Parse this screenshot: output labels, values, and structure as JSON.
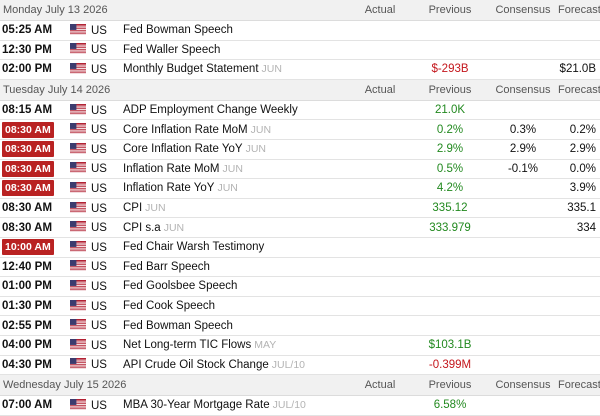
{
  "columns": {
    "actual": "Actual",
    "previous": "Previous",
    "consensus": "Consensus",
    "forecast": "Forecast"
  },
  "days": [
    {
      "label": "Monday July 13 2026",
      "events": [
        {
          "time": "05:25 AM",
          "highlight": false,
          "country": "US",
          "event": "Fed Bowman Speech",
          "ref": "",
          "actual": "",
          "actual_color": "",
          "previous": "",
          "previous_color": "",
          "consensus": "",
          "forecast": ""
        },
        {
          "time": "12:30 PM",
          "highlight": false,
          "country": "US",
          "event": "Fed Waller Speech",
          "ref": "",
          "actual": "",
          "actual_color": "",
          "previous": "",
          "previous_color": "",
          "consensus": "",
          "forecast": ""
        },
        {
          "time": "02:00 PM",
          "highlight": false,
          "country": "US",
          "event": "Monthly Budget Statement",
          "ref": "JUN",
          "actual": "",
          "actual_color": "",
          "previous": "$-293B",
          "previous_color": "red",
          "consensus": "",
          "forecast": "$21.0B"
        }
      ]
    },
    {
      "label": "Tuesday July 14 2026",
      "events": [
        {
          "time": "08:15 AM",
          "highlight": false,
          "country": "US",
          "event": "ADP Employment Change Weekly",
          "ref": "",
          "actual": "",
          "actual_color": "",
          "previous": "21.0K",
          "previous_color": "green",
          "consensus": "",
          "forecast": ""
        },
        {
          "time": "08:30 AM",
          "highlight": true,
          "country": "US",
          "event": "Core Inflation Rate MoM",
          "ref": "JUN",
          "actual": "",
          "actual_color": "",
          "previous": "0.2%",
          "previous_color": "green",
          "consensus": "0.3%",
          "forecast": "0.2%"
        },
        {
          "time": "08:30 AM",
          "highlight": true,
          "country": "US",
          "event": "Core Inflation Rate YoY",
          "ref": "JUN",
          "actual": "",
          "actual_color": "",
          "previous": "2.9%",
          "previous_color": "green",
          "consensus": "2.9%",
          "forecast": "2.9%"
        },
        {
          "time": "08:30 AM",
          "highlight": true,
          "country": "US",
          "event": "Inflation Rate MoM",
          "ref": "JUN",
          "actual": "",
          "actual_color": "",
          "previous": "0.5%",
          "previous_color": "green",
          "consensus": "-0.1%",
          "forecast": "0.0%"
        },
        {
          "time": "08:30 AM",
          "highlight": true,
          "country": "US",
          "event": "Inflation Rate YoY",
          "ref": "JUN",
          "actual": "",
          "actual_color": "",
          "previous": "4.2%",
          "previous_color": "green",
          "consensus": "",
          "forecast": "3.9%"
        },
        {
          "time": "08:30 AM",
          "highlight": false,
          "country": "US",
          "event": "CPI",
          "ref": "JUN",
          "actual": "",
          "actual_color": "",
          "previous": "335.12",
          "previous_color": "green",
          "consensus": "",
          "forecast": "335.1"
        },
        {
          "time": "08:30 AM",
          "highlight": false,
          "country": "US",
          "event": "CPI s.a",
          "ref": "JUN",
          "actual": "",
          "actual_color": "",
          "previous": "333.979",
          "previous_color": "green",
          "consensus": "",
          "forecast": "334"
        },
        {
          "time": "10:00 AM",
          "highlight": true,
          "country": "US",
          "event": "Fed Chair Warsh Testimony",
          "ref": "",
          "actual": "",
          "actual_color": "",
          "previous": "",
          "previous_color": "",
          "consensus": "",
          "forecast": ""
        },
        {
          "time": "12:40 PM",
          "highlight": false,
          "country": "US",
          "event": "Fed Barr Speech",
          "ref": "",
          "actual": "",
          "actual_color": "",
          "previous": "",
          "previous_color": "",
          "consensus": "",
          "forecast": ""
        },
        {
          "time": "01:00 PM",
          "highlight": false,
          "country": "US",
          "event": "Fed Goolsbee Speech",
          "ref": "",
          "actual": "",
          "actual_color": "",
          "previous": "",
          "previous_color": "",
          "consensus": "",
          "forecast": ""
        },
        {
          "time": "01:30 PM",
          "highlight": false,
          "country": "US",
          "event": "Fed Cook Speech",
          "ref": "",
          "actual": "",
          "actual_color": "",
          "previous": "",
          "previous_color": "",
          "consensus": "",
          "forecast": ""
        },
        {
          "time": "02:55 PM",
          "highlight": false,
          "country": "US",
          "event": "Fed Bowman Speech",
          "ref": "",
          "actual": "",
          "actual_color": "",
          "previous": "",
          "previous_color": "",
          "consensus": "",
          "forecast": ""
        },
        {
          "time": "04:00 PM",
          "highlight": false,
          "country": "US",
          "event": "Net Long-term TIC Flows",
          "ref": "MAY",
          "actual": "",
          "actual_color": "",
          "previous": "$103.1B",
          "previous_color": "green",
          "consensus": "",
          "forecast": ""
        },
        {
          "time": "04:30 PM",
          "highlight": false,
          "country": "US",
          "event": "API Crude Oil Stock Change",
          "ref": "JUL/10",
          "actual": "",
          "actual_color": "",
          "previous": "-0.399M",
          "previous_color": "red",
          "consensus": "",
          "forecast": ""
        }
      ]
    },
    {
      "label": "Wednesday July 15 2026",
      "events": [
        {
          "time": "07:00 AM",
          "highlight": false,
          "country": "US",
          "event": "MBA 30-Year Mortgage Rate",
          "ref": "JUL/10",
          "actual": "",
          "actual_color": "",
          "previous": "6.58%",
          "previous_color": "green",
          "consensus": "",
          "forecast": ""
        }
      ]
    }
  ],
  "colors": {
    "positive": "#22891f",
    "negative": "#c4161c",
    "highlight_time": "#b92222",
    "day_header_bg": "#f1f1f1"
  },
  "icons": {
    "country_flag": "us-flag-icon"
  }
}
